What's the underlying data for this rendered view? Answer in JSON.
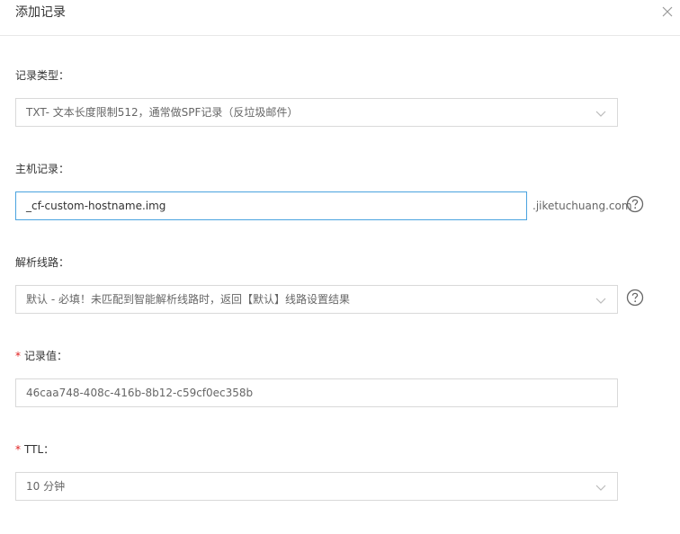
{
  "dialog": {
    "title": "添加记录"
  },
  "fields": {
    "record_type": {
      "label": "记录类型：",
      "value": "TXT- 文本长度限制512，通常做SPF记录（反垃圾邮件）"
    },
    "host": {
      "label": "主机记录：",
      "value": "_cf-custom-hostname.img",
      "suffix": ".jiketuchuang.com"
    },
    "line": {
      "label": "解析线路：",
      "value": "默认 - 必填！未匹配到智能解析线路时，返回【默认】线路设置结果"
    },
    "record_value": {
      "required_mark": "*",
      "label": "记录值：",
      "value": "46caa748-408c-416b-8b12-c59cf0ec358b"
    },
    "ttl": {
      "required_mark": "*",
      "label": "TTL：",
      "value": "10 分钟"
    }
  },
  "icons": {
    "close": "close-icon",
    "chevron": "chevron-down-icon",
    "help": "help-circle-icon"
  },
  "colors": {
    "focus_border": "#4aa3df",
    "required": "#e02020"
  }
}
